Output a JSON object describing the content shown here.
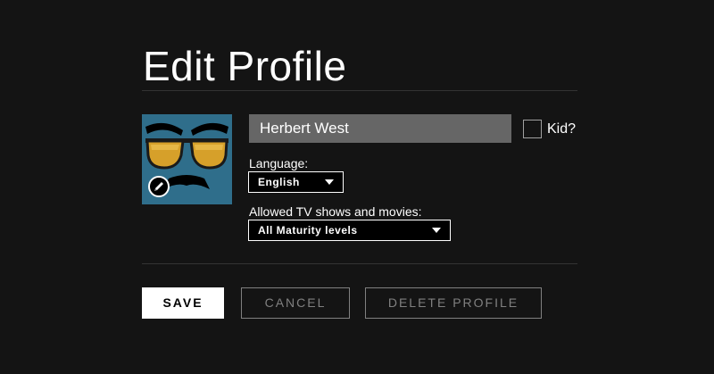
{
  "page": {
    "title": "Edit Profile"
  },
  "profile": {
    "name_value": "Herbert West",
    "avatar_icon": "sunglasses-mustache-avatar",
    "edit_icon": "pencil-icon",
    "kid_label": "Kid?",
    "kid_checked": false
  },
  "language": {
    "label": "Language:",
    "selected": "English"
  },
  "maturity": {
    "label": "Allowed TV shows and movies:",
    "selected": "All Maturity levels"
  },
  "buttons": {
    "save": "SAVE",
    "cancel": "CANCEL",
    "delete": "DELETE PROFILE"
  },
  "colors": {
    "background": "#141414",
    "avatar_bg": "#2f6e8b",
    "input_bg": "#666666",
    "muted": "#808080"
  }
}
